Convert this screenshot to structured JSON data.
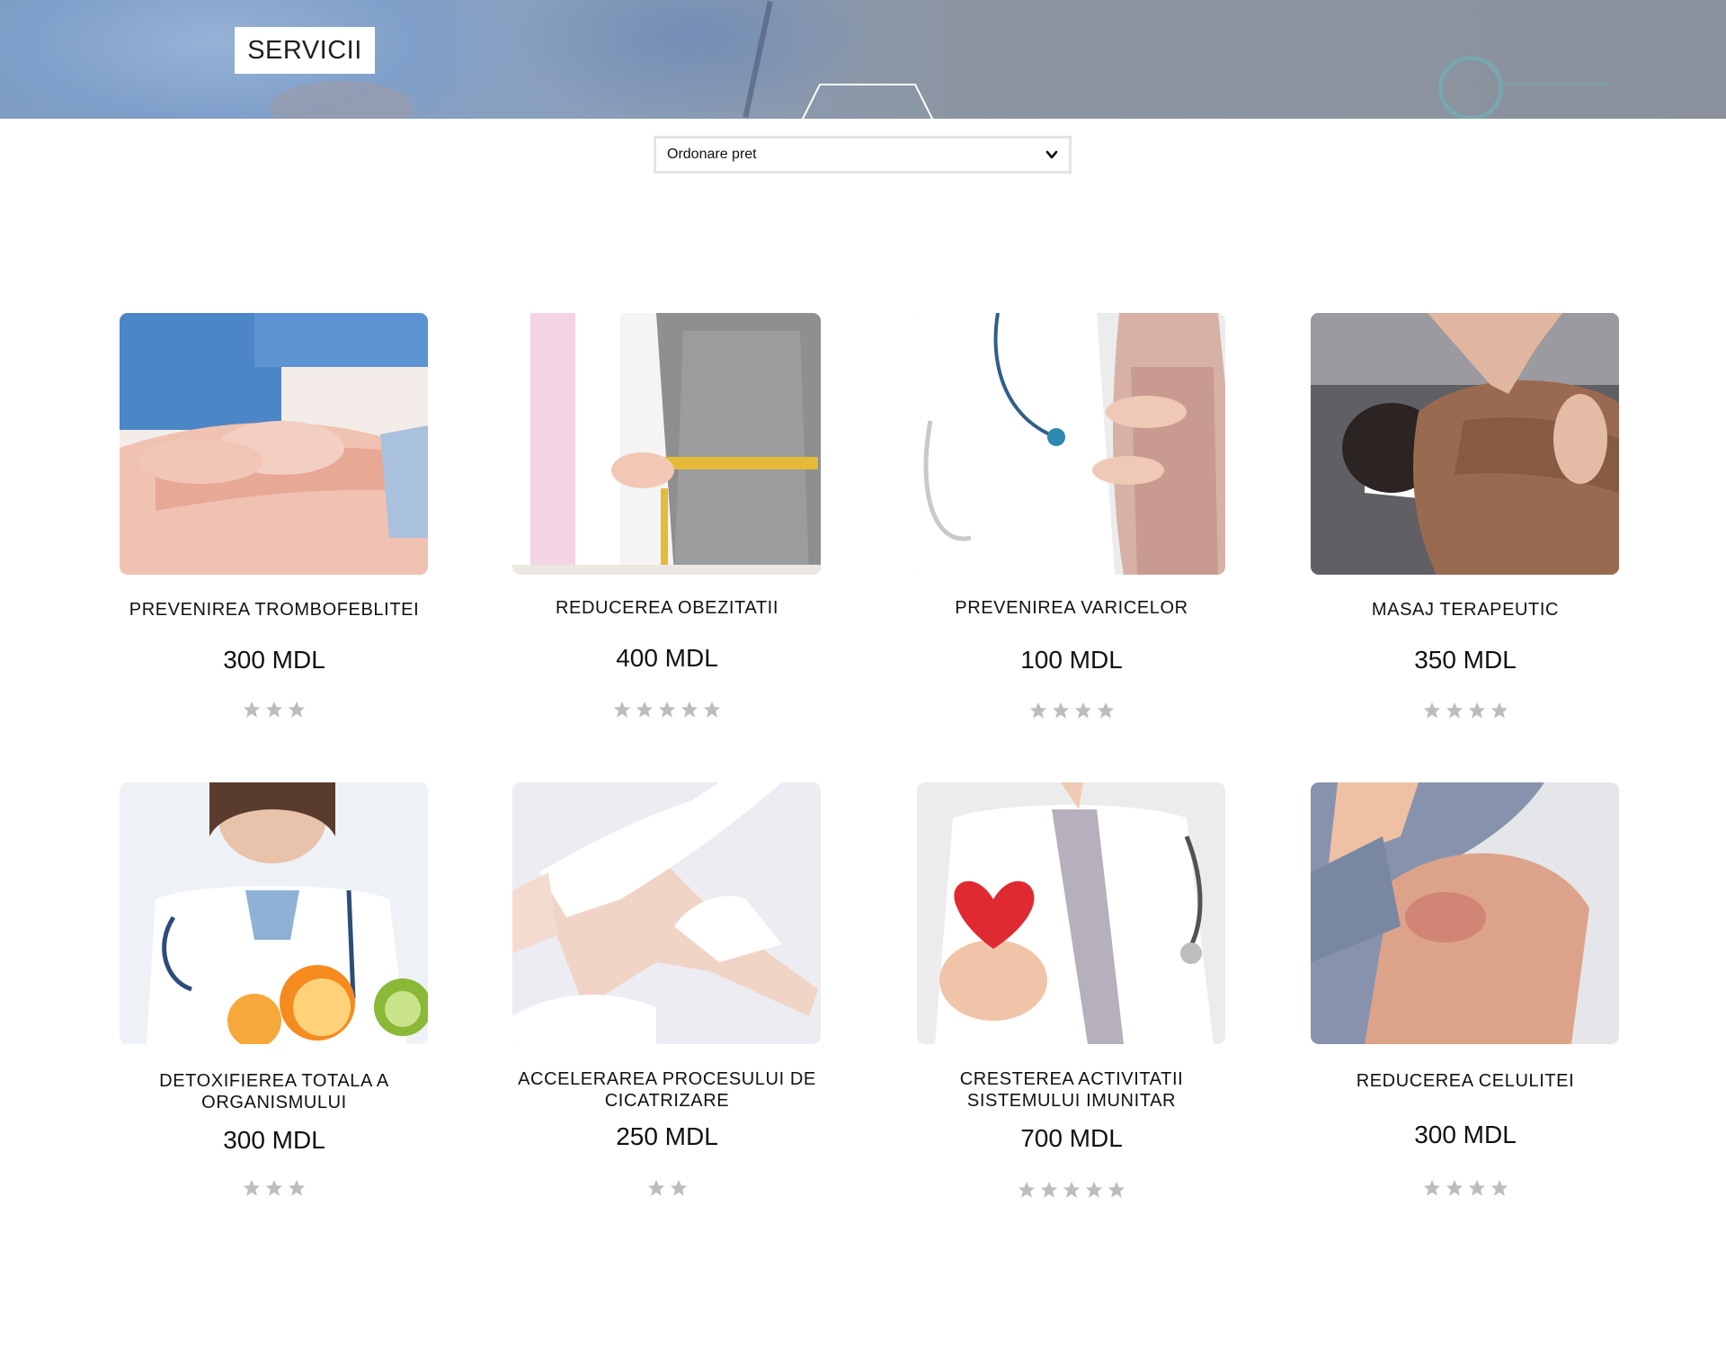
{
  "hero": {
    "title": "SERVICII"
  },
  "sort": {
    "selected": "Ordonare pret"
  },
  "services": [
    {
      "title_lines": [
        "PREVENIREA TROMBOFEBLITEI"
      ],
      "price": "300 MDL",
      "rating": 3,
      "image": "knee-massage"
    },
    {
      "title_lines": [
        "REDUCEREA OBEZITATII"
      ],
      "price": "400 MDL",
      "rating": 5,
      "image": "waist-measurement"
    },
    {
      "title_lines": [
        "PREVENIREA VARICELOR"
      ],
      "price": "100 MDL",
      "rating": 4,
      "image": "leg-examination"
    },
    {
      "title_lines": [
        "MASAJ TERAPEUTIC"
      ],
      "price": "350 MDL",
      "rating": 4,
      "image": "back-massage"
    },
    {
      "title_lines": [
        "DETOXIFIEREA TOTALA A",
        "ORGANISMULUI"
      ],
      "price": "300 MDL",
      "rating": 3,
      "image": "doctor-with-fruits"
    },
    {
      "title_lines": [
        "ACCELERAREA PROCESULUI DE",
        "CICATRIZARE"
      ],
      "price": "250 MDL",
      "rating": 2,
      "image": "bandaged-hand"
    },
    {
      "title_lines": [
        "CRESTEREA ACTIVITATII",
        "SISTEMULUI IMUNITAR"
      ],
      "price": "700 MDL",
      "rating": 5,
      "image": "doctor-with-heart"
    },
    {
      "title_lines": [
        "REDUCEREA CELULITEI"
      ],
      "price": "300 MDL",
      "rating": 4,
      "image": "arm-skin"
    }
  ],
  "colors": {
    "star": "#bdbdbd",
    "text": "#111111",
    "hero_overlay": "#8a9bb5"
  }
}
